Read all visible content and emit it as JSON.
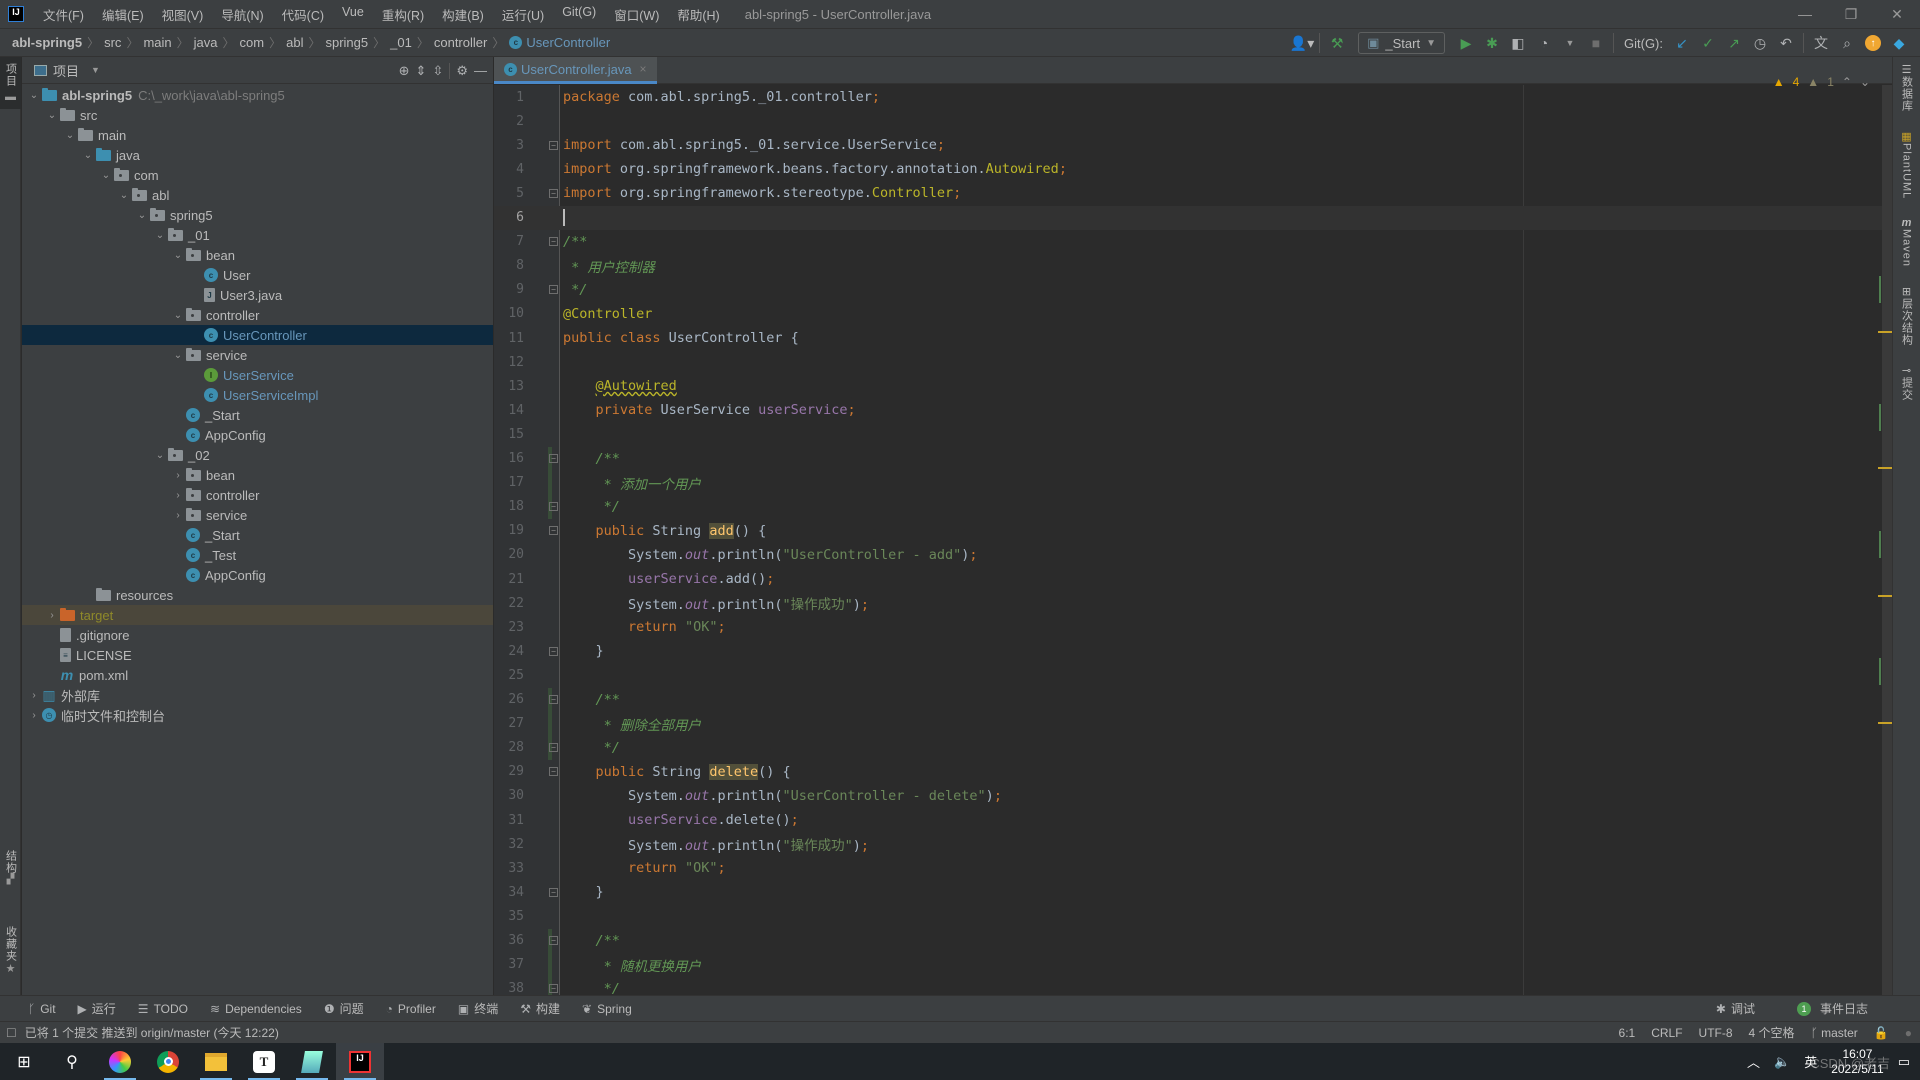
{
  "titlebar": {
    "logo": "IJ",
    "menu": [
      "文件(F)",
      "编辑(E)",
      "视图(V)",
      "导航(N)",
      "代码(C)",
      "Vue",
      "重构(R)",
      "构建(B)",
      "运行(U)",
      "Git(G)",
      "窗口(W)",
      "帮助(H)"
    ],
    "window_title": "abl-spring5 - UserController.java",
    "controls": {
      "minimize": "—",
      "restore": "❐",
      "close": "✕"
    }
  },
  "navbar": {
    "breadcrumbs": [
      "abl-spring5",
      "src",
      "main",
      "java",
      "com",
      "abl",
      "spring5",
      "_01",
      "controller",
      "UserController"
    ],
    "run_config": "_Start",
    "git_label": "Git(G):"
  },
  "left_stripe": {
    "top_tab": "项目",
    "bottom_tabs": [
      "结构",
      "收藏夹"
    ]
  },
  "project_panel": {
    "title": "项目",
    "tree": [
      {
        "label": "abl-spring5",
        "path": "C:\\_work\\java\\abl-spring5",
        "depth": 0,
        "arrow": "open",
        "icon": "module"
      },
      {
        "label": "src",
        "depth": 1,
        "arrow": "open",
        "icon": "folder"
      },
      {
        "label": "main",
        "depth": 2,
        "arrow": "open",
        "icon": "folder"
      },
      {
        "label": "java",
        "depth": 3,
        "arrow": "open",
        "icon": "src-folder"
      },
      {
        "label": "com",
        "depth": 4,
        "arrow": "open",
        "icon": "package"
      },
      {
        "label": "abl",
        "depth": 5,
        "arrow": "open",
        "icon": "package"
      },
      {
        "label": "spring5",
        "depth": 6,
        "arrow": "open",
        "icon": "package"
      },
      {
        "label": "_01",
        "depth": 7,
        "arrow": "open",
        "icon": "package"
      },
      {
        "label": "bean",
        "depth": 8,
        "arrow": "open",
        "icon": "package"
      },
      {
        "label": "User",
        "depth": 9,
        "arrow": "none",
        "icon": "class"
      },
      {
        "label": "User3.java",
        "depth": 9,
        "arrow": "none",
        "icon": "java-file"
      },
      {
        "label": "controller",
        "depth": 8,
        "arrow": "open",
        "icon": "package"
      },
      {
        "label": "UserController",
        "depth": 9,
        "arrow": "none",
        "icon": "class",
        "selected": true,
        "color": "blue"
      },
      {
        "label": "service",
        "depth": 8,
        "arrow": "open",
        "icon": "package"
      },
      {
        "label": "UserService",
        "depth": 9,
        "arrow": "none",
        "icon": "interface",
        "color": "blue"
      },
      {
        "label": "UserServiceImpl",
        "depth": 9,
        "arrow": "none",
        "icon": "class",
        "color": "blue"
      },
      {
        "label": "_Start",
        "depth": 8,
        "arrow": "none",
        "icon": "class-runnable"
      },
      {
        "label": "AppConfig",
        "depth": 8,
        "arrow": "none",
        "icon": "class"
      },
      {
        "label": "_02",
        "depth": 7,
        "arrow": "open",
        "icon": "package"
      },
      {
        "label": "bean",
        "depth": 8,
        "arrow": "closed",
        "icon": "package"
      },
      {
        "label": "controller",
        "depth": 8,
        "arrow": "closed",
        "icon": "package"
      },
      {
        "label": "service",
        "depth": 8,
        "arrow": "closed",
        "icon": "package"
      },
      {
        "label": "_Start",
        "depth": 8,
        "arrow": "none",
        "icon": "class-runnable"
      },
      {
        "label": "_Test",
        "depth": 8,
        "arrow": "none",
        "icon": "class-runnable"
      },
      {
        "label": "AppConfig",
        "depth": 8,
        "arrow": "none",
        "icon": "class"
      },
      {
        "label": "resources",
        "depth": 3,
        "arrow": "none",
        "icon": "resources-folder"
      },
      {
        "label": "target",
        "depth": 1,
        "arrow": "closed",
        "icon": "excluded-folder",
        "excluded": true
      },
      {
        "label": ".gitignore",
        "depth": 1,
        "arrow": "none",
        "icon": "ignore-file"
      },
      {
        "label": "LICENSE",
        "depth": 1,
        "arrow": "none",
        "icon": "text-file"
      },
      {
        "label": "pom.xml",
        "depth": 1,
        "arrow": "none",
        "icon": "maven-file"
      },
      {
        "label": "外部库",
        "depth": 0,
        "arrow": "closed",
        "icon": "libraries"
      },
      {
        "label": "临时文件和控制台",
        "depth": 0,
        "arrow": "closed",
        "icon": "scratches"
      }
    ]
  },
  "editor": {
    "tab": {
      "label": "UserController.java",
      "close": "×"
    },
    "inspections": {
      "warnings": "4",
      "weak_warnings": "1"
    },
    "current_line": 6,
    "lines": [
      [
        {
          "t": "package ",
          "c": "k"
        },
        {
          "t": "com.abl.spring5._01.controller"
        },
        {
          "t": ";",
          "c": "k"
        }
      ],
      [],
      [
        {
          "t": "import ",
          "c": "k"
        },
        {
          "t": "com.abl.spring5._01.service.UserService"
        },
        {
          "t": ";",
          "c": "k"
        }
      ],
      [
        {
          "t": "import ",
          "c": "k"
        },
        {
          "t": "org.springframework.beans.factory.annotation."
        },
        {
          "t": "Autowired",
          "c": "ann"
        },
        {
          "t": ";",
          "c": "k"
        }
      ],
      [
        {
          "t": "import ",
          "c": "k"
        },
        {
          "t": "org.springframework.stereotype."
        },
        {
          "t": "Controller",
          "c": "ann"
        },
        {
          "t": ";",
          "c": "k"
        }
      ],
      [
        {
          "t": "",
          "c": "caret"
        }
      ],
      [
        {
          "t": "/**",
          "c": "cm"
        }
      ],
      [
        {
          "t": " * 用户控制器",
          "c": "cm"
        }
      ],
      [
        {
          "t": " */",
          "c": "cm"
        }
      ],
      [
        {
          "t": "@Controller",
          "c": "ann"
        }
      ],
      [
        {
          "t": "public class ",
          "c": "k"
        },
        {
          "t": "UserController {"
        }
      ],
      [],
      [
        {
          "t": "    "
        },
        {
          "t": "@Autowired",
          "c": "ann wavy"
        }
      ],
      [
        {
          "t": "    "
        },
        {
          "t": "private ",
          "c": "k"
        },
        {
          "t": "UserService "
        },
        {
          "t": "userService",
          "c": "fld"
        },
        {
          "t": ";",
          "c": "k"
        }
      ],
      [],
      [
        {
          "t": "    "
        },
        {
          "t": "/**",
          "c": "cm"
        }
      ],
      [
        {
          "t": "     * 添加一个用户",
          "c": "cm"
        }
      ],
      [
        {
          "t": "     */",
          "c": "cm"
        }
      ],
      [
        {
          "t": "    "
        },
        {
          "t": "public ",
          "c": "k"
        },
        {
          "t": "String "
        },
        {
          "t": "add",
          "c": "hl"
        },
        {
          "t": "() {"
        }
      ],
      [
        {
          "t": "        System."
        },
        {
          "t": "out",
          "c": "st"
        },
        {
          "t": ".println("
        },
        {
          "t": "\"UserController - add\"",
          "c": "str"
        },
        {
          "t": ")"
        },
        {
          "t": ";",
          "c": "k"
        }
      ],
      [
        {
          "t": "        "
        },
        {
          "t": "userService",
          "c": "fld"
        },
        {
          "t": ".add()"
        },
        {
          "t": ";",
          "c": "k"
        }
      ],
      [
        {
          "t": "        System."
        },
        {
          "t": "out",
          "c": "st"
        },
        {
          "t": ".println("
        },
        {
          "t": "\"操作成功\"",
          "c": "str"
        },
        {
          "t": ")"
        },
        {
          "t": ";",
          "c": "k"
        }
      ],
      [
        {
          "t": "        "
        },
        {
          "t": "return ",
          "c": "k"
        },
        {
          "t": "\"OK\"",
          "c": "str"
        },
        {
          "t": ";",
          "c": "k"
        }
      ],
      [
        {
          "t": "    }"
        }
      ],
      [],
      [
        {
          "t": "    "
        },
        {
          "t": "/**",
          "c": "cm"
        }
      ],
      [
        {
          "t": "     * 删除全部用户",
          "c": "cm"
        }
      ],
      [
        {
          "t": "     */",
          "c": "cm"
        }
      ],
      [
        {
          "t": "    "
        },
        {
          "t": "public ",
          "c": "k"
        },
        {
          "t": "String "
        },
        {
          "t": "delete",
          "c": "hl"
        },
        {
          "t": "() {"
        }
      ],
      [
        {
          "t": "        System."
        },
        {
          "t": "out",
          "c": "st"
        },
        {
          "t": ".println("
        },
        {
          "t": "\"UserController - delete\"",
          "c": "str"
        },
        {
          "t": ")"
        },
        {
          "t": ";",
          "c": "k"
        }
      ],
      [
        {
          "t": "        "
        },
        {
          "t": "userService",
          "c": "fld"
        },
        {
          "t": ".delete()"
        },
        {
          "t": ";",
          "c": "k"
        }
      ],
      [
        {
          "t": "        System."
        },
        {
          "t": "out",
          "c": "st"
        },
        {
          "t": ".println("
        },
        {
          "t": "\"操作成功\"",
          "c": "str"
        },
        {
          "t": ")"
        },
        {
          "t": ";",
          "c": "k"
        }
      ],
      [
        {
          "t": "        "
        },
        {
          "t": "return ",
          "c": "k"
        },
        {
          "t": "\"OK\"",
          "c": "str"
        },
        {
          "t": ";",
          "c": "k"
        }
      ],
      [
        {
          "t": "    }"
        }
      ],
      [],
      [
        {
          "t": "    "
        },
        {
          "t": "/**",
          "c": "cm"
        }
      ],
      [
        {
          "t": "     * 随机更换用户",
          "c": "cm"
        }
      ],
      [
        {
          "t": "     */",
          "c": "cm"
        }
      ]
    ],
    "fold_lines": [
      3,
      5,
      7,
      9,
      16,
      18,
      19,
      24,
      26,
      28,
      29,
      34,
      36,
      38
    ],
    "vcs_changed_ranges": [
      [
        16,
        18
      ],
      [
        26,
        28
      ],
      [
        36,
        38
      ]
    ]
  },
  "right_stripe": [
    "数据库",
    "PlantUML",
    "Maven",
    "层次结构",
    "提交"
  ],
  "bottom_tools": {
    "left": [
      {
        "icon": "git-branch-icon",
        "label": "Git"
      },
      {
        "icon": "run-icon",
        "label": "运行"
      },
      {
        "icon": "todo-icon",
        "label": "TODO"
      },
      {
        "icon": "dependencies-icon",
        "label": "Dependencies"
      },
      {
        "icon": "problems-icon",
        "label": "问题"
      },
      {
        "icon": "profiler-icon",
        "label": "Profiler"
      },
      {
        "icon": "terminal-icon",
        "label": "终端"
      },
      {
        "icon": "build-icon",
        "label": "构建"
      },
      {
        "icon": "spring-icon",
        "label": "Spring"
      }
    ],
    "right": [
      {
        "icon": "debug-icon",
        "label": "调试"
      },
      {
        "icon": "event-log-badge",
        "badge": "1",
        "label": "事件日志"
      }
    ]
  },
  "statusbar": {
    "message": "已将 1 个提交 推送到 origin/master (今天 12:22)",
    "position": "6:1",
    "line_sep": "CRLF",
    "encoding": "UTF-8",
    "indent": "4 个空格",
    "branch": "master"
  },
  "taskbar": {
    "ime": "英",
    "time": "16:07",
    "date": "2022/5/11",
    "watermark": "CSDN @老吉"
  }
}
